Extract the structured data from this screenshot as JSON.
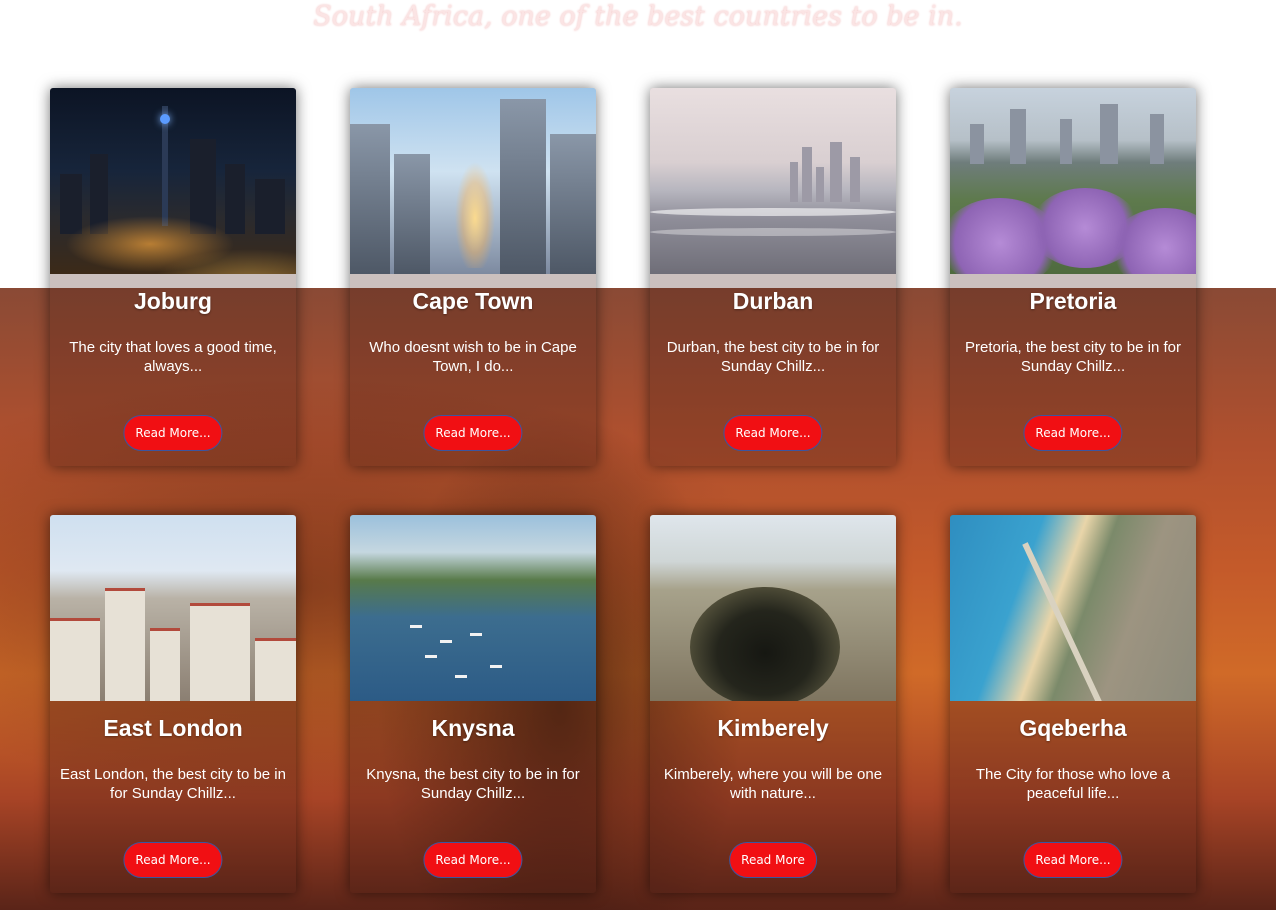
{
  "heading": "South Africa, one of the best countries to be in.",
  "cards": [
    {
      "title": "Joburg",
      "description": "The city that loves a good time, always...",
      "button": "Read More..."
    },
    {
      "title": "Cape Town",
      "description": "Who doesnt wish to be in Cape Town, I do...",
      "button": "Read More..."
    },
    {
      "title": "Durban",
      "description": "Durban, the best city to be in for Sunday Chillz...",
      "button": "Read More..."
    },
    {
      "title": "Pretoria",
      "description": "Pretoria, the best city to be in for Sunday Chillz...",
      "button": "Read More..."
    },
    {
      "title": "East London",
      "description": "East London, the best city to be in for Sunday Chillz...",
      "button": "Read More..."
    },
    {
      "title": "Knysna",
      "description": "Knysna, the best city to be in for Sunday Chillz...",
      "button": "Read More..."
    },
    {
      "title": "Kimberely",
      "description": "Kimberely, where you will be one with nature...",
      "button": "Read More"
    },
    {
      "title": "Gqeberha",
      "description": "The City for those who love a peaceful life...",
      "button": "Read More..."
    }
  ],
  "colors": {
    "button_bg": "#f10f13",
    "heading_text": "#fbe4e4"
  }
}
